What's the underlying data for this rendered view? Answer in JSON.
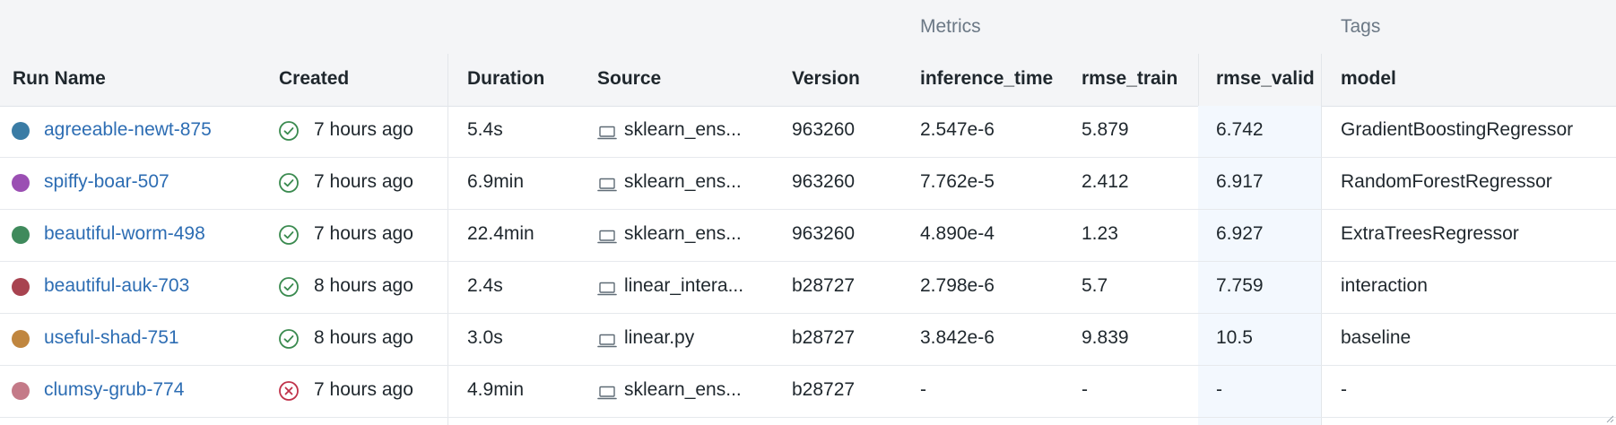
{
  "group_headers": {
    "metrics": "Metrics",
    "tags": "Tags"
  },
  "columns": {
    "run_name": "Run Name",
    "created": "Created",
    "duration": "Duration",
    "source": "Source",
    "version": "Version",
    "inference_time": "inference_time",
    "rmse_train": "rmse_train",
    "rmse_valid": "rmse_valid",
    "model": "model"
  },
  "rows": [
    {
      "name": "agreeable-newt-875",
      "color": "#3a7ca5",
      "status": "success",
      "created": "7 hours ago",
      "duration": "5.4s",
      "source": "sklearn_ens...",
      "version": "963260",
      "inference_time": "2.547e-6",
      "rmse_train": "5.879",
      "rmse_valid": "6.742",
      "model": "GradientBoostingRegressor"
    },
    {
      "name": "spiffy-boar-507",
      "color": "#9b4fb3",
      "status": "success",
      "created": "7 hours ago",
      "duration": "6.9min",
      "source": "sklearn_ens...",
      "version": "963260",
      "inference_time": "7.762e-5",
      "rmse_train": "2.412",
      "rmse_valid": "6.917",
      "model": "RandomForestRegressor"
    },
    {
      "name": "beautiful-worm-498",
      "color": "#3f8a5c",
      "status": "success",
      "created": "7 hours ago",
      "duration": "22.4min",
      "source": "sklearn_ens...",
      "version": "963260",
      "inference_time": "4.890e-4",
      "rmse_train": "1.23",
      "rmse_valid": "6.927",
      "model": "ExtraTreesRegressor"
    },
    {
      "name": "beautiful-auk-703",
      "color": "#a84350",
      "status": "success",
      "created": "8 hours ago",
      "duration": "2.4s",
      "source": "linear_intera...",
      "version": "b28727",
      "inference_time": "2.798e-6",
      "rmse_train": "5.7",
      "rmse_valid": "7.759",
      "model": "interaction"
    },
    {
      "name": "useful-shad-751",
      "color": "#c0863f",
      "status": "success",
      "created": "8 hours ago",
      "duration": "3.0s",
      "source": "linear.py",
      "version": "b28727",
      "inference_time": "3.842e-6",
      "rmse_train": "9.839",
      "rmse_valid": "10.5",
      "model": "baseline"
    },
    {
      "name": "clumsy-grub-774",
      "color": "#c47a88",
      "status": "failed",
      "created": "7 hours ago",
      "duration": "4.9min",
      "source": "sklearn_ens...",
      "version": "b28727",
      "inference_time": "-",
      "rmse_train": "-",
      "rmse_valid": "-",
      "model": "-"
    }
  ],
  "icons": {
    "success": "check-circle-icon",
    "failed": "x-circle-icon",
    "source": "laptop-icon"
  },
  "colors": {
    "link": "#2d6db3",
    "success": "#3a8a4f",
    "failed": "#c0324a",
    "header_bg": "#f4f5f7",
    "highlight_col_bg": "#f3f8fe"
  }
}
